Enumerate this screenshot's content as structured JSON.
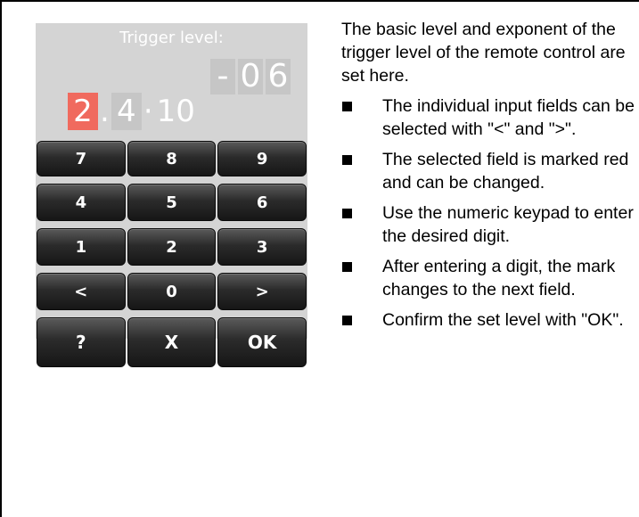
{
  "panel": {
    "title": "Trigger level:",
    "exponent": {
      "sign": "-",
      "d1": "0",
      "d2": "6"
    },
    "mantissa": {
      "d1": "2",
      "dot": ".",
      "d2": "4",
      "times": "·",
      "base": "10"
    },
    "selected_color": "#f06a5e",
    "keypad": {
      "rows": [
        [
          "7",
          "8",
          "9"
        ],
        [
          "4",
          "5",
          "6"
        ],
        [
          "1",
          "2",
          "3"
        ],
        [
          "<",
          "0",
          ">"
        ],
        [
          "?",
          "X",
          "OK"
        ]
      ]
    }
  },
  "description": {
    "intro": "The basic level and exponent of the trigger level of the remote control are set here.",
    "bullets": [
      "The individual input fields can be selected with \"<\" and \">\".",
      "The selected field is marked red and can be changed.",
      "Use the numeric keypad to enter the desired digit.",
      "After entering a digit, the mark changes to the next field.",
      "Confirm the set level with \"OK\"."
    ]
  }
}
